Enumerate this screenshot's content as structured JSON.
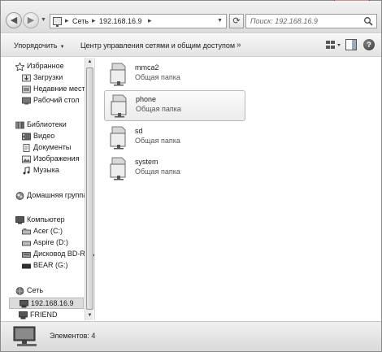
{
  "address_bar": {
    "segments": [
      "Сеть",
      "192.168.16.9"
    ],
    "separator": "▸"
  },
  "search": {
    "placeholder": "Поиск: 192.168.16.9"
  },
  "toolbar": {
    "organize_label": "Упорядочить",
    "network_center_label": "Центр управления сетями и общим доступом",
    "more_label": "»"
  },
  "nav": {
    "favorites": {
      "header": "Избранное",
      "items": [
        "Загрузки",
        "Недавние места",
        "Рабочий стол"
      ]
    },
    "libraries": {
      "header": "Библиотеки",
      "items": [
        "Видео",
        "Документы",
        "Изображения",
        "Музыка"
      ]
    },
    "homegroup": {
      "header": "Домашняя группа"
    },
    "computer": {
      "header": "Компьютер",
      "items": [
        "Acer (C:)",
        "Aspire (D:)",
        "Дисковод BD-ROM",
        "BEAR (G:)"
      ]
    },
    "network": {
      "header": "Сеть",
      "items": [
        "192.168.16.9",
        "FRIEND"
      ],
      "selected": "192.168.16.9"
    }
  },
  "folders": [
    {
      "name": "mmca2",
      "type": "Общая папка",
      "selected": false
    },
    {
      "name": "phone",
      "type": "Общая папка",
      "selected": true
    },
    {
      "name": "sd",
      "type": "Общая папка",
      "selected": false
    },
    {
      "name": "system",
      "type": "Общая папка",
      "selected": false
    }
  ],
  "status": {
    "items_count": "Элементов: 4"
  },
  "icons": {
    "back": "back-arrow-icon",
    "forward": "forward-arrow-icon",
    "refresh": "refresh-icon",
    "search": "search-icon",
    "help": "help-icon"
  }
}
